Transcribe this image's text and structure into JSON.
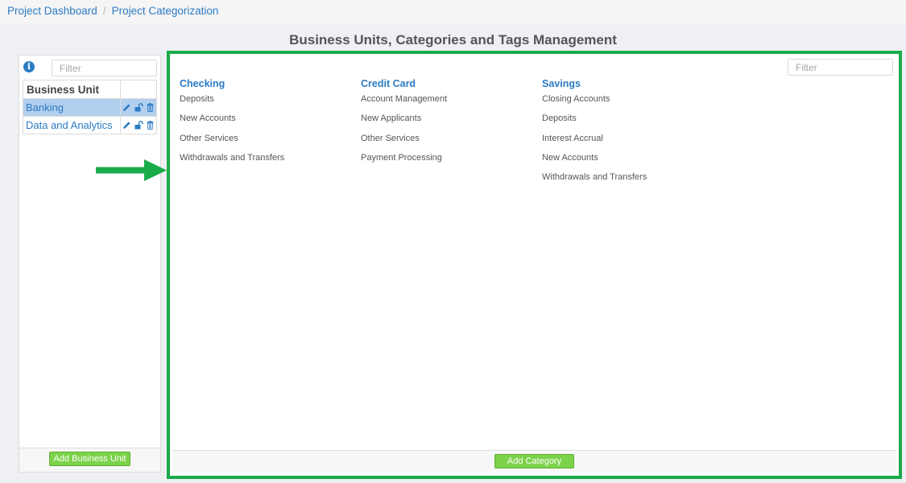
{
  "breadcrumb": {
    "items": [
      "Project Dashboard",
      "Project Categorization"
    ],
    "separator": "/"
  },
  "page_title": "Business Units, Categories and Tags Management",
  "left_panel": {
    "info_icon": "info-icon",
    "filter_placeholder": "Filter",
    "table_header": "Business Unit",
    "rows": [
      {
        "name": "Banking",
        "selected": true
      },
      {
        "name": "Data and Analytics",
        "selected": false
      }
    ],
    "row_action_icons": [
      "pencil-icon",
      "unlock-icon",
      "trash-icon"
    ],
    "add_button": "Add Business Unit"
  },
  "main_panel": {
    "filter_placeholder": "Filter",
    "categories": [
      {
        "title": "Checking",
        "items": [
          "Deposits",
          "New Accounts",
          "Other Services",
          "Withdrawals and Transfers"
        ]
      },
      {
        "title": "Credit Card",
        "items": [
          "Account Management",
          "New Applicants",
          "Other Services",
          "Payment Processing"
        ]
      },
      {
        "title": "Savings",
        "items": [
          "Closing Accounts",
          "Deposits",
          "Interest Accrual",
          "New Accounts",
          "Withdrawals and Transfers"
        ]
      }
    ],
    "add_button": "Add Category"
  },
  "colors": {
    "link_blue": "#2b7bc4",
    "highlight_green": "#1aab4b",
    "button_green": "#7cd24a",
    "selected_row": "#b3cfee"
  }
}
